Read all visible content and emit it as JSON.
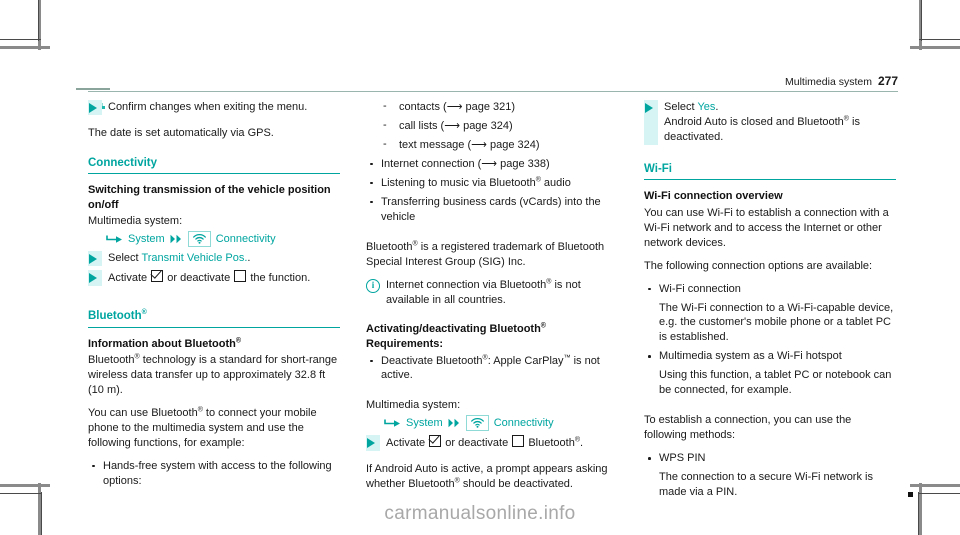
{
  "header": {
    "title": "Multimedia system",
    "page_number": "277"
  },
  "watermark": "carmanualsonline.info",
  "col1": {
    "step_confirm": "Confirm changes when exiting the menu.",
    "para_date": "The date is set automatically via GPS.",
    "connectivity_heading": "Connectivity",
    "switching_subhead": "Switching transmission of the vehicle position on/off",
    "multimedia_label": "Multimedia system:",
    "nav_system": "System",
    "nav_connectivity": "Connectivity",
    "step_select_prefix": "Select ",
    "step_select_link": "Transmit Vehicle Pos.",
    "step_select_suffix": ".",
    "step_activate_pre": "Activate ",
    "step_activate_mid": " or deactivate ",
    "step_activate_post": " the function.",
    "bluetooth_heading": "Bluetooth",
    "info_about_subhead": "Information about Bluetooth",
    "para_bt_standard_a": "Bluetooth",
    "para_bt_standard_b": " technology is a standard for short-range wireless data transfer up to approximately 32.8 ft (10 m).",
    "para_bt_use_a": "You can use Bluetooth",
    "para_bt_use_b": " to connect your mobile phone to the multimedia system and use the following functions, for example:",
    "bullet_handsfree": "Hands-free system with access to the following options:"
  },
  "col2": {
    "dash_contacts": "contacts (",
    "dash_contacts_page": " page 321)",
    "dash_calllists": "call lists (",
    "dash_calllists_page": " page 324)",
    "dash_textmessage": "text message (",
    "dash_textmessage_page": " page 324)",
    "bullet_internet": "Internet connection (",
    "bullet_internet_page": " page 338)",
    "bullet_listening_a": "Listening to music via Bluetooth",
    "bullet_listening_b": " audio",
    "bullet_transfer": "Transferring business cards (vCards) into the vehicle",
    "para_trademark_a": "Bluetooth",
    "para_trademark_b": " is a registered trademark of Bluetooth Special Interest Group (SIG) Inc.",
    "note_internet_a": "Internet connection via Bluetooth",
    "note_internet_b": " is not available in all countries.",
    "activating_subhead_a": "Activating/deactivating Bluetooth",
    "activating_subhead_b": "Requirements:",
    "bullet_deactivate_a": "Deactivate Bluetooth",
    "bullet_deactivate_b": ": Apple CarPlay",
    "bullet_deactivate_c": " is not active.",
    "multimedia_label": "Multimedia system:",
    "nav_system": "System",
    "nav_connectivity": "Connectivity",
    "step_activate_pre": "Activate ",
    "step_activate_mid": " or deactivate ",
    "step_activate_post_a": " Bluetooth",
    "step_activate_post_b": ".",
    "para_android_a": "If Android Auto is active, a prompt appears asking whether Bluetooth",
    "para_android_b": " should be deactivated."
  },
  "col3": {
    "step_select_prefix": "Select ",
    "step_select_link": "Yes",
    "step_select_suffix": ".",
    "step_select_detail_a": "Android Auto is closed and Bluetooth",
    "step_select_detail_b": " is deactivated.",
    "wifi_heading": "Wi-Fi",
    "wifi_overview_subhead": "Wi-Fi connection overview",
    "para_wifi_use": "You can use Wi-Fi to establish a connection with a Wi-Fi network and to access the Internet or other network devices.",
    "para_options_avail": "The following connection options are available:",
    "bullet_wifi_conn": "Wi-Fi connection",
    "bullet_wifi_conn_detail": "The Wi-Fi connection to a Wi-Fi-capable device, e.g. the customer's mobile phone or a tablet PC is established.",
    "bullet_hotspot": "Multimedia system as a Wi-Fi hotspot",
    "bullet_hotspot_detail": "Using this function, a tablet PC or notebook can be connected, for example.",
    "para_establish": "To establish a connection, you can use the following methods:",
    "bullet_wps": "WPS PIN",
    "bullet_wps_detail": "The connection to a secure Wi-Fi network is made via a PIN."
  },
  "colors": {
    "teal": "#00a5a0",
    "band": "#d5f4f3",
    "rule": "#9ab5ae"
  }
}
